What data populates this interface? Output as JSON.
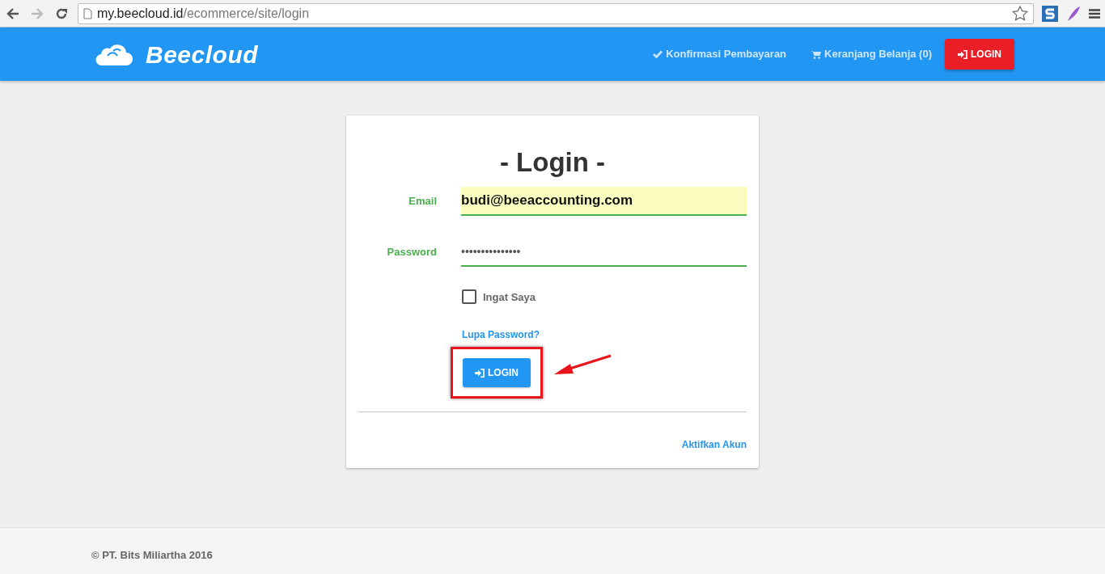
{
  "browser": {
    "url_domain": "my.beecloud.id",
    "url_path": "/ecommerce/site/login",
    "forward_disabled": true
  },
  "navbar": {
    "brand": "Beecloud",
    "links": [
      {
        "kind": "check",
        "label": "Konfirmasi Pembayaran"
      },
      {
        "kind": "cart",
        "label": "Keranjang Belanja (0)"
      }
    ],
    "login_button": "LOGIN"
  },
  "login": {
    "title": "- Login -",
    "email": {
      "label": "Email",
      "value": "budi@beeaccounting.com"
    },
    "password": {
      "label": "Password",
      "value": "•••••••••••••••"
    },
    "remember": {
      "label": "Ingat Saya",
      "checked": false
    },
    "forgot_link": "Lupa Password?",
    "submit": "LOGIN",
    "activate_link": "Aktifkan Akun"
  },
  "footer": "© PT. Bits Miliartha 2016"
}
